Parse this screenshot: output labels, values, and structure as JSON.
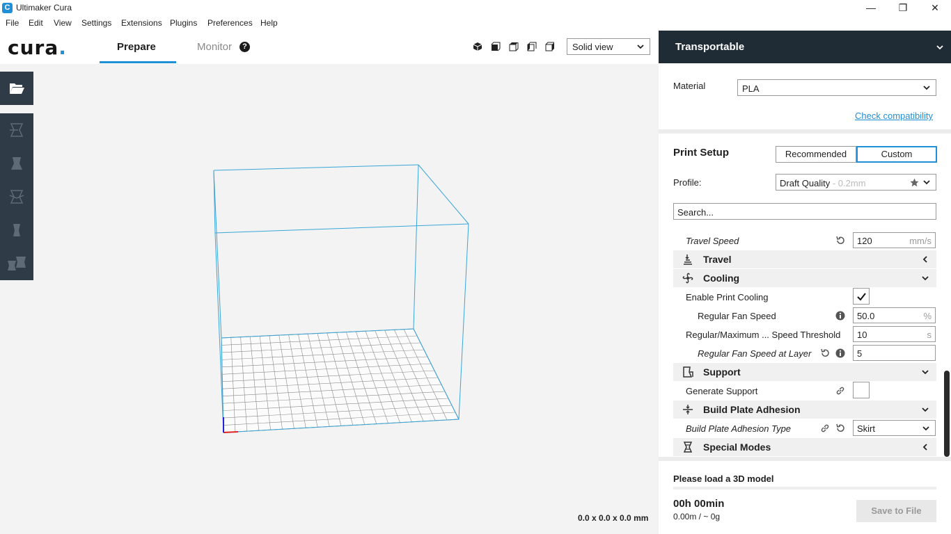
{
  "window": {
    "title": "Ultimaker Cura",
    "app_icon_glyph": "C"
  },
  "menu": [
    "File",
    "Edit",
    "View",
    "Settings",
    "Extensions",
    "Plugins",
    "Preferences",
    "Help"
  ],
  "header": {
    "logo_text": "cura",
    "logo_dot": ".",
    "tabs": {
      "prepare": "Prepare",
      "monitor": "Monitor"
    },
    "view_select": "Solid view"
  },
  "viewport": {
    "dimensions": "0.0 x 0.0 x 0.0 mm"
  },
  "panel": {
    "printer": "Transportable",
    "material_label": "Material",
    "material_value": "PLA",
    "check_compatibility": "Check compatibility",
    "print_setup": "Print Setup",
    "mode_recommended": "Recommended",
    "mode_custom": "Custom",
    "profile_label": "Profile:",
    "profile_value": "Draft Quality",
    "profile_sub": " - 0.2mm",
    "search_placeholder": "Search..."
  },
  "settings": {
    "travel_speed": {
      "label": "Travel Speed",
      "value": "120",
      "unit": "mm/s"
    },
    "travel": "Travel",
    "cooling": "Cooling",
    "enable_cooling": "Enable Print Cooling",
    "fan_speed": {
      "label": "Regular Fan Speed",
      "value": "50.0",
      "unit": "%"
    },
    "threshold": {
      "label": "Regular/Maximum ... Speed Threshold",
      "value": "10",
      "unit": "s"
    },
    "fan_layer": {
      "label": "Regular Fan Speed at Layer",
      "value": "5"
    },
    "support": "Support",
    "generate_support": "Generate Support",
    "adhesion": "Build Plate Adhesion",
    "adhesion_type": {
      "label": "Build Plate Adhesion Type",
      "value": "Skirt"
    },
    "special_modes": "Special Modes"
  },
  "footer": {
    "load_msg": "Please load a 3D model",
    "time": "00h 00min",
    "usage": "0.00m / ~ 0g",
    "save": "Save to File"
  },
  "colors": {
    "accent": "#1f8fd6",
    "dark": "#2f3b47",
    "printer_bar": "#1f2b35"
  }
}
